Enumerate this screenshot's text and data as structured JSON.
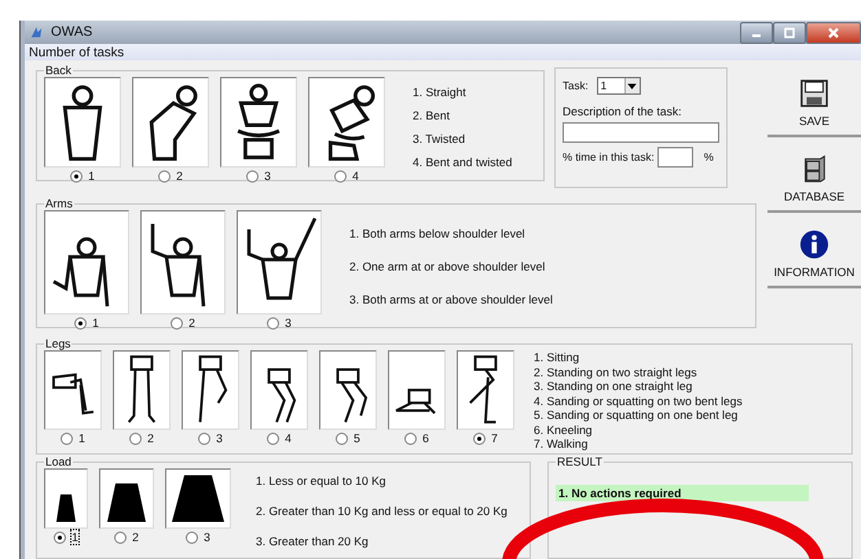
{
  "window": {
    "title": "OWAS"
  },
  "menu": {
    "label": "Number of tasks"
  },
  "back": {
    "title": "Back",
    "options": [
      {
        "label": "1",
        "selected": true
      },
      {
        "label": "2",
        "selected": false
      },
      {
        "label": "3",
        "selected": false
      },
      {
        "label": "4",
        "selected": false
      }
    ],
    "descriptions": [
      "1. Straight",
      "2. Bent",
      "3. Twisted",
      "4. Bent and twisted"
    ]
  },
  "task": {
    "label": "Task:",
    "value": "1",
    "description_label": "Description of the task:",
    "time_label": "% time in this task:",
    "time_unit": "%"
  },
  "arms": {
    "title": "Arms",
    "options": [
      {
        "label": "1",
        "selected": true
      },
      {
        "label": "2",
        "selected": false
      },
      {
        "label": "3",
        "selected": false
      }
    ],
    "descriptions": [
      "1. Both arms below shoulder level",
      "2. One arm at or above shoulder level",
      "3. Both arms at or above shoulder level"
    ]
  },
  "legs": {
    "title": "Legs",
    "options": [
      {
        "label": "1",
        "selected": false
      },
      {
        "label": "2",
        "selected": false
      },
      {
        "label": "3",
        "selected": false
      },
      {
        "label": "4",
        "selected": false
      },
      {
        "label": "5",
        "selected": false
      },
      {
        "label": "6",
        "selected": false
      },
      {
        "label": "7",
        "selected": true
      }
    ],
    "descriptions": [
      "1. Sitting",
      "2. Standing on two straight legs",
      "3. Standing on one straight leg",
      "4. Sanding or squatting on two bent legs",
      "5. Sanding or squatting on one bent leg",
      "6. Kneeling",
      "7. Walking"
    ]
  },
  "load": {
    "title": "Load",
    "options": [
      {
        "label": "1",
        "selected": true
      },
      {
        "label": "2",
        "selected": false
      },
      {
        "label": "3",
        "selected": false
      }
    ],
    "descriptions": [
      "1. Less or equal to 10 Kg",
      "2. Greater than 10 Kg and less or equal to 20 Kg",
      "3. Greater than 20 Kg"
    ]
  },
  "result": {
    "title": "RESULT",
    "text": "1. No actions required"
  },
  "buttons": [
    {
      "label": "SAVE",
      "kind": "save"
    },
    {
      "label": "DATABASE",
      "kind": "database"
    },
    {
      "label": "INFORMATION",
      "kind": "info"
    }
  ]
}
